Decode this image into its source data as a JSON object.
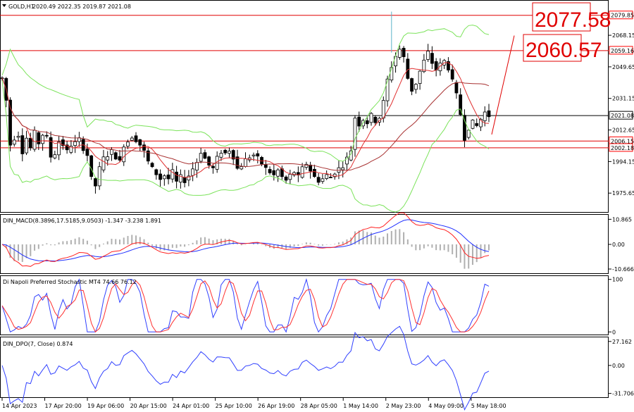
{
  "colors": {
    "bg": "#ffffff",
    "candle": "#000000",
    "bollinger": "#7be35a",
    "ma_fast": "#e03030",
    "ma_slow": "#a83232",
    "hline_red": "#e00000",
    "hline_black": "#000000",
    "macd_line": "#ff2020",
    "macd_signal": "#2030ff",
    "macd_hist": "#b0b0b0",
    "stoch_k": "#3040ff",
    "stoch_d": "#ff3030",
    "dpo": "#3040ff",
    "tag_red": "#ff0000"
  },
  "header": {
    "menu_icon": "triangle-down-icon",
    "symbol": "GOLD,H1",
    "ohlc": "2020.49 2022.35 2019.87 2021.08"
  },
  "annotations": {
    "target_1": "2077.58",
    "target_2": "2060.57"
  },
  "chart_data": [
    {
      "type": "candlestick",
      "panel": "main",
      "title": "GOLD,H1",
      "ylim": [
        1965,
        2088
      ],
      "y_ticks": [
        "2068.15",
        "2049.65",
        "2031.15",
        "2012.65",
        "1994.15",
        "1975.65"
      ],
      "y_tick_values": [
        2068.15,
        2049.65,
        2031.15,
        2012.65,
        1994.15,
        1975.65
      ],
      "x_ticks": [
        "14 Apr 2023",
        "17 Apr 20:00",
        "19 Apr 06:00",
        "20 Apr 15:00",
        "24 Apr 01:00",
        "25 Apr 10:00",
        "26 Apr 19:00",
        "28 Apr 05:00",
        "1 May 14:00",
        "2 May 23:00",
        "4 May 09:00",
        "5 May 18:00"
      ],
      "last_price": 2021.08,
      "horizontal_levels": [
        {
          "value": 2079.85,
          "label": "2079.85",
          "color": "red"
        },
        {
          "value": 2059.16,
          "label": "2059.16",
          "color": "red"
        },
        {
          "value": 2021.08,
          "label": "2021.08",
          "color": "black"
        },
        {
          "value": 2006.15,
          "label": "2006.15",
          "color": "red"
        },
        {
          "value": 2002.18,
          "label": "2002.18",
          "color": "red"
        }
      ],
      "close_path": [
        2043,
        2030,
        2004,
        2008,
        2010,
        2000,
        2008,
        2002,
        2011,
        2005,
        2010,
        2008,
        1997,
        1999,
        2006,
        2004,
        2000,
        2004,
        2005,
        2007,
        2002,
        1998,
        1984,
        1980,
        1990,
        1996,
        1998,
        2000,
        1997,
        1994,
        2004,
        2006,
        2009,
        2007,
        2004,
        2000,
        1994,
        1990,
        1987,
        1984,
        1986,
        1984,
        1988,
        1982,
        1985,
        1983,
        1986,
        1990,
        1994,
        2000,
        1996,
        1992,
        1990,
        1996,
        2000,
        1999,
        2001,
        1997,
        1990,
        1992,
        1995,
        1997,
        1998,
        1996,
        1993,
        1990,
        1988,
        1986,
        1989,
        1985,
        1983,
        1986,
        1988,
        1985,
        1990,
        1993,
        1989,
        1985,
        1983,
        1984,
        1986,
        1985,
        1988,
        1990,
        1992,
        1996,
        2001,
        2020,
        2016,
        2019,
        2017,
        2021,
        2018,
        2020,
        2029,
        2042,
        2050,
        2056,
        2060,
        2055,
        2043,
        2036,
        2040,
        2047,
        2053,
        2058,
        2052,
        2048,
        2051,
        2053,
        2049,
        2041,
        2033,
        2022,
        2008,
        2014,
        2017,
        2015,
        2019,
        2023,
        2021
      ]
    },
    {
      "type": "line",
      "panel": "macd",
      "title": "DIN_MACD(8.3896,17.5185,9.0503) -1.347 -3.238 1.891",
      "ylim": [
        -12.5,
        12.5
      ],
      "y_ticks": [
        "10.865",
        "0.00",
        "-10.666"
      ],
      "y_tick_values": [
        10.865,
        0,
        -10.666
      ],
      "current": {
        "macd": -1.347,
        "signal": -3.238,
        "hist": 1.891
      }
    },
    {
      "type": "line",
      "panel": "stochastic",
      "title": "Di Napoli Preferred Stochastic MT4 74.66 76.12",
      "ylim": [
        -5,
        105
      ],
      "y_ticks": [
        "100",
        "0"
      ],
      "y_tick_values": [
        100,
        0
      ],
      "current": {
        "k": 74.66,
        "d": 76.12
      }
    },
    {
      "type": "line",
      "panel": "dpo",
      "title": "DIN_DPO(7, Close) 0.874",
      "ylim": [
        -36,
        31
      ],
      "y_ticks": [
        "27.162",
        "0.00",
        "-31.706"
      ],
      "y_tick_values": [
        27.162,
        0,
        -31.706
      ],
      "current": 0.874
    }
  ]
}
